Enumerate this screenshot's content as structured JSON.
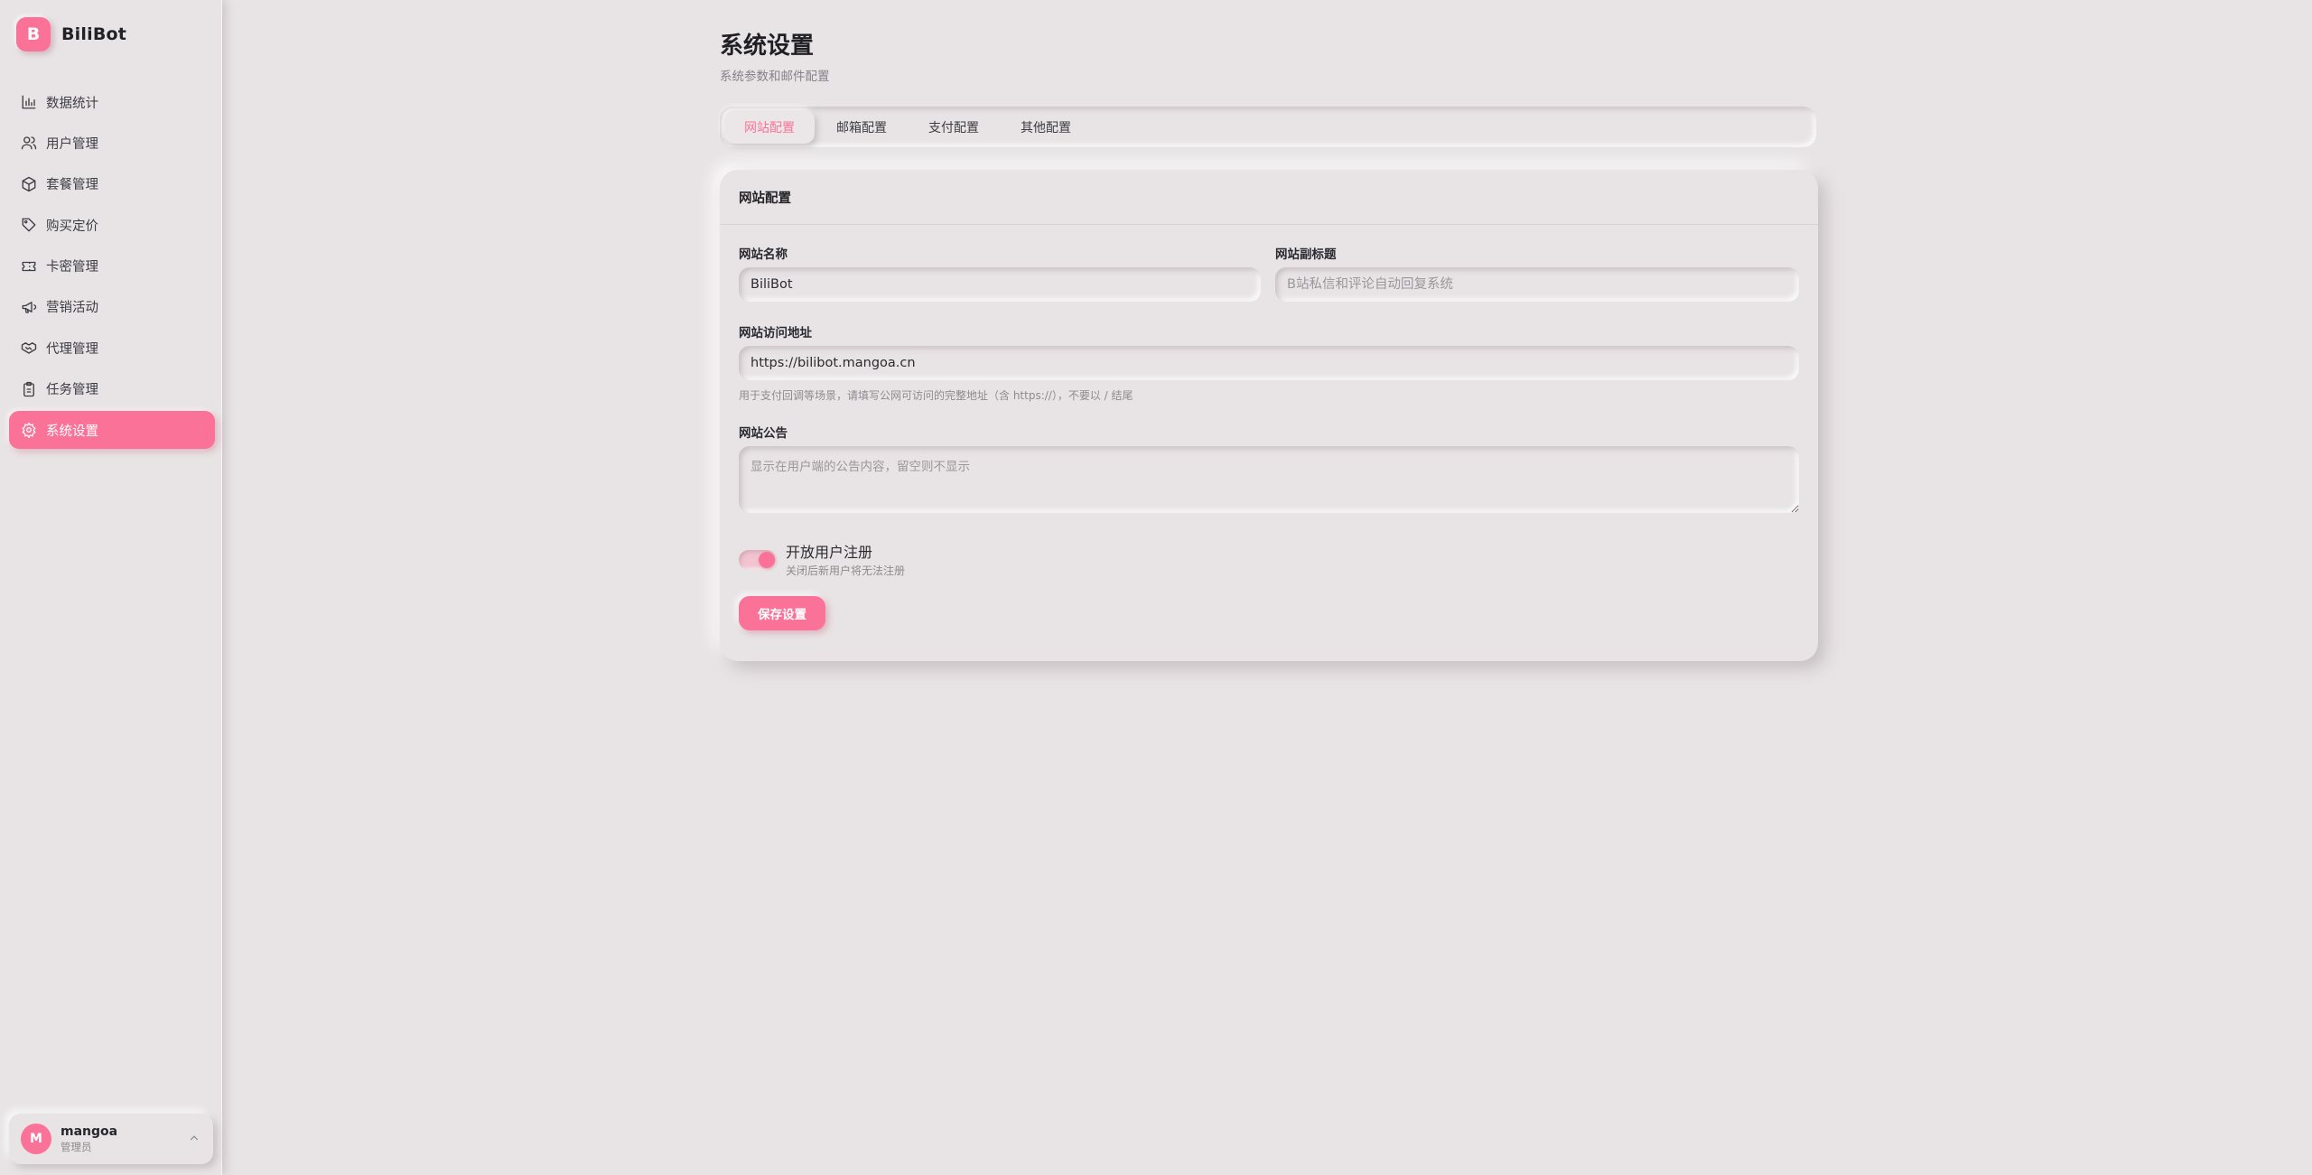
{
  "brand": {
    "logo_letter": "B",
    "name": "BiliBot",
    "accent": "#fb7299"
  },
  "sidebar": {
    "items": [
      {
        "label": "数据统计",
        "icon": "bar-chart-icon"
      },
      {
        "label": "用户管理",
        "icon": "users-icon"
      },
      {
        "label": "套餐管理",
        "icon": "package-icon"
      },
      {
        "label": "购买定价",
        "icon": "tag-icon"
      },
      {
        "label": "卡密管理",
        "icon": "ticket-icon"
      },
      {
        "label": "营销活动",
        "icon": "megaphone-icon"
      },
      {
        "label": "代理管理",
        "icon": "handshake-icon"
      },
      {
        "label": "任务管理",
        "icon": "clipboard-icon"
      },
      {
        "label": "系统设置",
        "icon": "gear-icon",
        "active": true
      }
    ]
  },
  "user": {
    "avatar_letter": "M",
    "name": "mangoa",
    "role": "管理员"
  },
  "page": {
    "title": "系统设置",
    "subtitle": "系统参数和邮件配置"
  },
  "tabs": [
    {
      "label": "网站配置",
      "active": true
    },
    {
      "label": "邮箱配置"
    },
    {
      "label": "支付配置"
    },
    {
      "label": "其他配置"
    }
  ],
  "card": {
    "title": "网站配置",
    "site_name": {
      "label": "网站名称",
      "value": "BiliBot"
    },
    "site_subtitle": {
      "label": "网站副标题",
      "value": "",
      "placeholder": "B站私信和评论自动回复系统"
    },
    "site_url": {
      "label": "网站访问地址",
      "value": "https://bilibot.mangoa.cn",
      "hint": "用于支付回调等场景，请填写公网可访问的完整地址（含 https://），不要以 / 结尾"
    },
    "announcement": {
      "label": "网站公告",
      "value": "",
      "placeholder": "显示在用户端的公告内容，留空则不显示"
    },
    "registration": {
      "title": "开放用户注册",
      "subtitle": "关闭后新用户将无法注册",
      "enabled": true
    },
    "save_label": "保存设置"
  }
}
